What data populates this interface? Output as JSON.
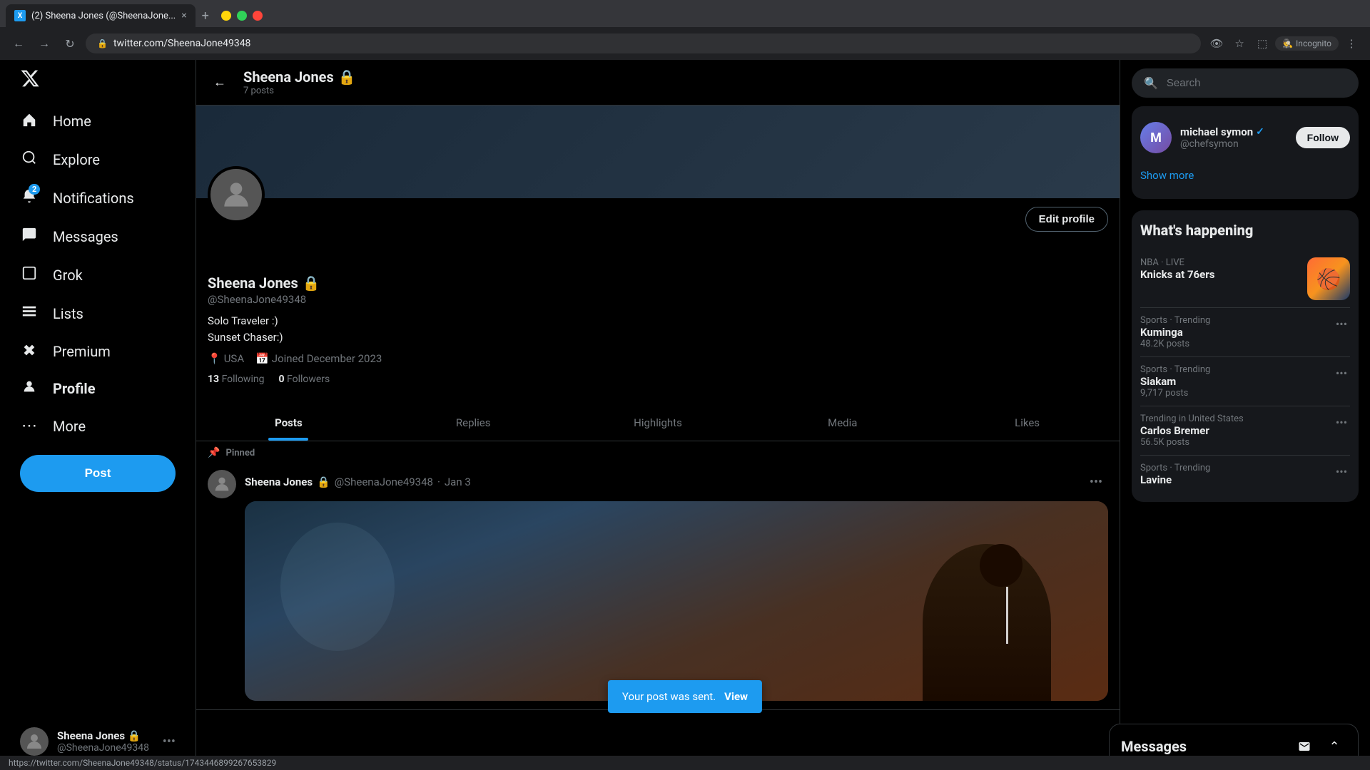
{
  "browser": {
    "tab_label": "(2) Sheena Jones (@SheenaJone...",
    "url": "twitter.com/SheenaJone49348",
    "incognito_label": "Incognito"
  },
  "sidebar": {
    "logo_label": "X",
    "nav_items": [
      {
        "id": "home",
        "label": "Home",
        "icon": "🏠",
        "active": false
      },
      {
        "id": "explore",
        "label": "Explore",
        "icon": "🔍",
        "active": false
      },
      {
        "id": "notifications",
        "label": "Notifications",
        "icon": "🔔",
        "active": false,
        "badge": "2"
      },
      {
        "id": "messages",
        "label": "Messages",
        "icon": "✉️",
        "active": false
      },
      {
        "id": "grok",
        "label": "Grok",
        "icon": "✏️",
        "active": false
      },
      {
        "id": "lists",
        "label": "Lists",
        "icon": "📋",
        "active": false
      },
      {
        "id": "premium",
        "label": "Premium",
        "icon": "✖",
        "active": false
      },
      {
        "id": "profile",
        "label": "Profile",
        "icon": "👤",
        "active": true
      },
      {
        "id": "more",
        "label": "More",
        "icon": "⋯",
        "active": false
      }
    ],
    "post_button_label": "Post",
    "user": {
      "name": "Sheena Jones",
      "handle": "@SheenaJone49348",
      "lock_icon": "🔒"
    }
  },
  "profile": {
    "header_name": "Sheena Jones",
    "header_posts_count": "7 posts",
    "lock_icon": "🔒",
    "display_name": "Sheena Jones",
    "handle": "@SheenaJone49348",
    "bio_line1": "Solo Traveler :)",
    "bio_line2": "Sunset Chaser:)",
    "location": "USA",
    "joined": "Joined December 2023",
    "following_count": "13",
    "following_label": "Following",
    "followers_count": "0",
    "followers_label": "Followers",
    "edit_profile_label": "Edit profile"
  },
  "tabs": [
    {
      "id": "posts",
      "label": "Posts",
      "active": true
    },
    {
      "id": "replies",
      "label": "Replies",
      "active": false
    },
    {
      "id": "highlights",
      "label": "Highlights",
      "active": false
    },
    {
      "id": "media",
      "label": "Media",
      "active": false
    },
    {
      "id": "likes",
      "label": "Likes",
      "active": false
    }
  ],
  "post": {
    "pinned_label": "Pinned",
    "author_name": "Sheena Jones",
    "author_handle": "@SheenaJone49348",
    "date": "Jan 3",
    "lock_icon": "🔒"
  },
  "toast": {
    "message": "Your post was sent.",
    "view_label": "View"
  },
  "right_sidebar": {
    "search_placeholder": "Search",
    "who_to_follow_title": "What's happening",
    "follow_items": [
      {
        "name": "michael symon",
        "handle": "@chefsymon",
        "verified": true,
        "follow_label": "Follow"
      }
    ],
    "show_more_label": "Show more",
    "trending_title": "What's happening",
    "trends": [
      {
        "category": "NBA · LIVE",
        "name": "Knicks at 76ers",
        "count": "",
        "has_image": true
      },
      {
        "category": "Sports · Trending",
        "name": "Kuminga",
        "count": "48.2K posts",
        "has_image": false
      },
      {
        "category": "Sports · Trending",
        "name": "Siakam",
        "count": "9,717 posts",
        "has_image": false
      },
      {
        "category": "Trending in United States",
        "name": "Carlos Bremer",
        "count": "56.5K posts",
        "has_image": false
      },
      {
        "category": "Sports · Trending",
        "name": "Lavine",
        "count": "",
        "has_image": false
      }
    ]
  },
  "messages_panel": {
    "title": "Messages"
  },
  "status_bar": {
    "url": "https://twitter.com/SheenaJone49348/status/1743446899267653829"
  }
}
